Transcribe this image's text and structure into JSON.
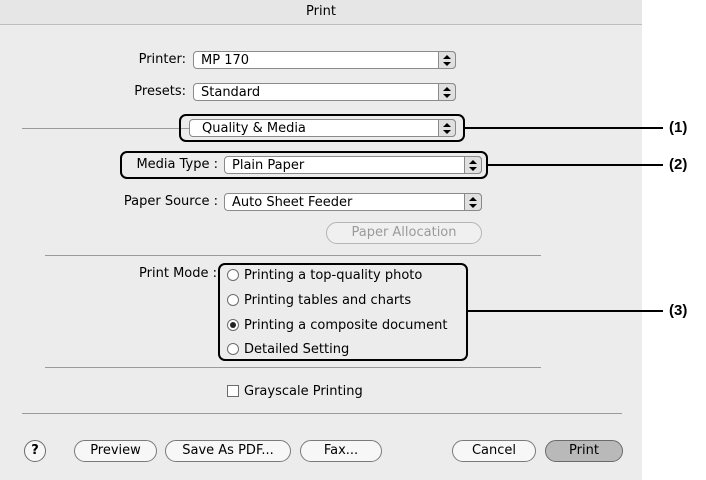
{
  "window": {
    "title": "Print"
  },
  "printer": {
    "label": "Printer:",
    "value": "MP 170"
  },
  "presets": {
    "label": "Presets:",
    "value": "Standard"
  },
  "panel": {
    "value": "Quality & Media"
  },
  "media_type": {
    "label": "Media Type :",
    "value": "Plain Paper"
  },
  "paper_source": {
    "label": "Paper Source :",
    "value": "Auto Sheet Feeder"
  },
  "paper_allocation": {
    "label": "Paper Allocation"
  },
  "print_mode": {
    "label": "Print Mode :",
    "options": [
      {
        "label": "Printing a top-quality photo",
        "selected": false
      },
      {
        "label": "Printing tables and charts",
        "selected": false
      },
      {
        "label": "Printing a composite document",
        "selected": true
      },
      {
        "label": "Detailed Setting",
        "selected": false
      }
    ]
  },
  "grayscale": {
    "label": "Grayscale Printing",
    "checked": false
  },
  "buttons": {
    "help": "?",
    "preview": "Preview",
    "save_pdf": "Save As PDF...",
    "fax": "Fax...",
    "cancel": "Cancel",
    "print": "Print"
  },
  "callouts": {
    "c1": "(1)",
    "c2": "(2)",
    "c3": "(3)"
  }
}
